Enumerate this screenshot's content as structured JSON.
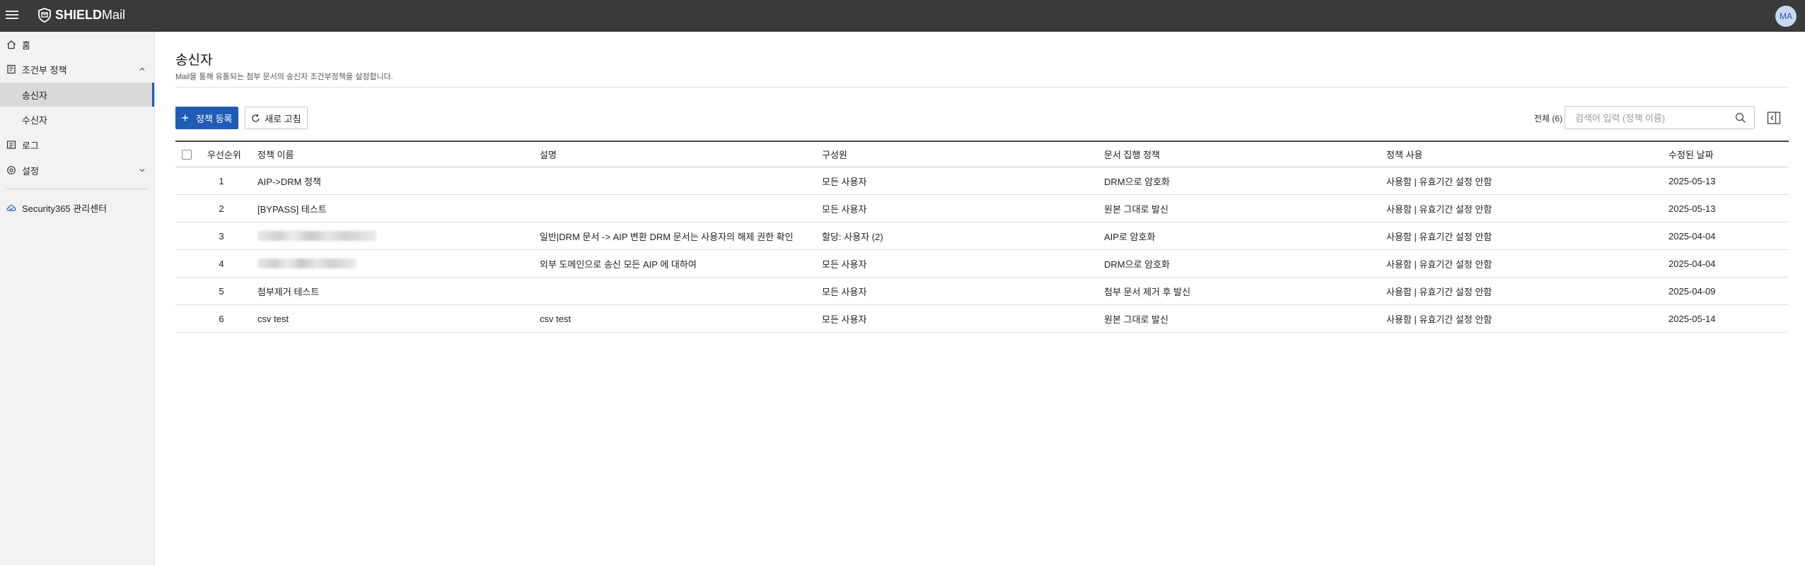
{
  "app": {
    "brand_bold": "SHIELD",
    "brand_rest": "Mail",
    "user_initials": "MA"
  },
  "sidebar": {
    "items": [
      {
        "label": "홈",
        "icon": "home-icon"
      },
      {
        "label": "조건부 정책",
        "icon": "policy-icon"
      },
      {
        "label": "송신자"
      },
      {
        "label": "수신자"
      },
      {
        "label": "로그",
        "icon": "log-icon"
      },
      {
        "label": "설정",
        "icon": "gear-icon"
      },
      {
        "label": "Security365 관리센터",
        "icon": "cloud-icon"
      }
    ]
  },
  "page": {
    "title": "송신자",
    "description": "Mail을 통해 유통되는 첨부 문서의 송신자 조건부정책을 설정합니다."
  },
  "toolbar": {
    "add_label": "정책 등록",
    "refresh_label": "새로 고침",
    "total_label": "전체 (6)",
    "search_placeholder": "검색어 입력 (정책 이름)"
  },
  "table": {
    "headers": [
      "우선순위",
      "정책 이름",
      "설명",
      "구성원",
      "문서 집행 정책",
      "정책 사용",
      "수정된 날짜"
    ],
    "rows": [
      {
        "priority": "1",
        "name": "AIP->DRM 정책",
        "desc": "",
        "member": "모든 사용자",
        "exec": "DRM으로 암호화",
        "use": "사용함 | 유효기간 설정 안함",
        "date": "2025-05-13"
      },
      {
        "priority": "2",
        "name": "[BYPASS] 테스트",
        "desc": "",
        "member": "모든 사용자",
        "exec": "원본 그대로 발신",
        "use": "사용함 | 유효기간 설정 안함",
        "date": "2025-05-13"
      },
      {
        "priority": "3",
        "name": "",
        "desc": "일반|DRM 문서 -> AIP 변환 DRM 문서는 사용자의 해제 권한 확인",
        "member": "할당: 사용자 (2)",
        "exec": "AIP로 암호화",
        "use": "사용함 | 유효기간 설정 안함",
        "date": "2025-04-04"
      },
      {
        "priority": "4",
        "name": "",
        "desc": "외부 도메인으로 송신 모든 AIP 에 대하여",
        "member": "모든 사용자",
        "exec": "DRM으로 암호화",
        "use": "사용함 | 유효기간 설정 안함",
        "date": "2025-04-04"
      },
      {
        "priority": "5",
        "name": "첨부제거 테스트",
        "desc": "",
        "member": "모든 사용자",
        "exec": "첨부 문서 제거 후 발신",
        "use": "사용함 | 유효기간 설정 안함",
        "date": "2025-04-09"
      },
      {
        "priority": "6",
        "name": "csv test",
        "desc": "csv test",
        "member": "모든 사용자",
        "exec": "원본 그대로 발신",
        "use": "사용함 | 유효기간 설정 안함",
        "date": "2025-05-14"
      }
    ]
  },
  "colors": {
    "topbar": "#3a3a3a",
    "accent": "#1f5cb5",
    "sidebar_bg": "#f2f2f2"
  }
}
